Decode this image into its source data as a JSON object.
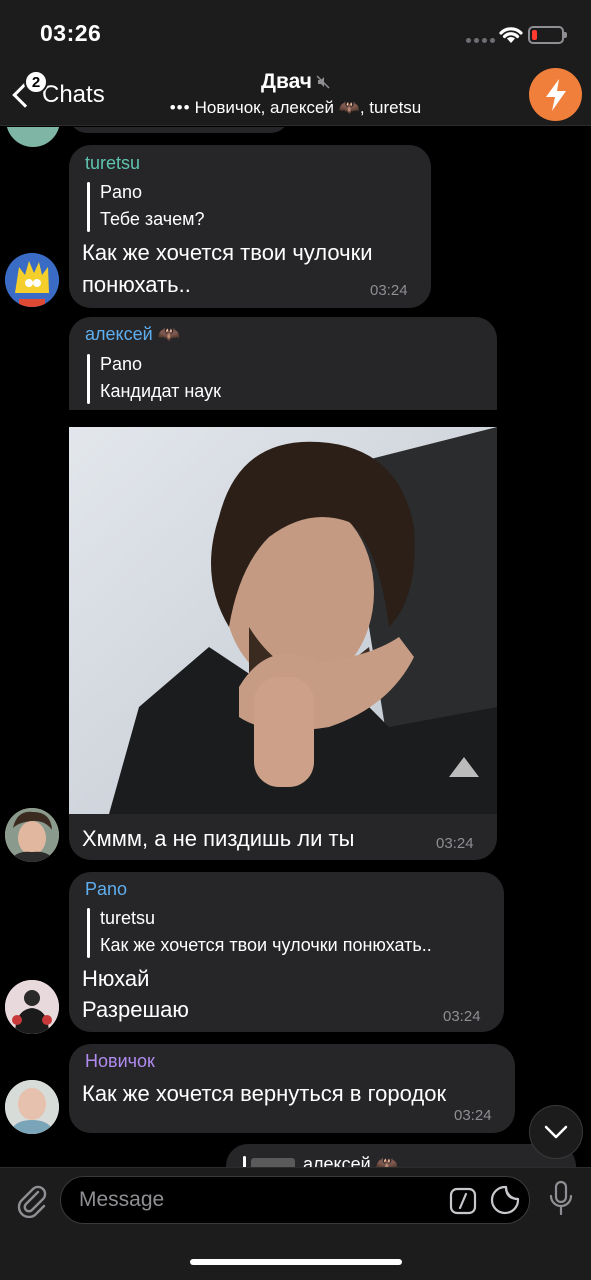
{
  "status_bar": {
    "time": "03:26"
  },
  "header": {
    "back_label": "Chats",
    "unread_badge": "2",
    "title": "Двач",
    "subtitle_dots": "•••",
    "subtitle": "Новичок, алексей 🦇, turetsu"
  },
  "messages": [
    {
      "sender": "turetsu",
      "sender_color": "#5ec4b0",
      "reply_name": "Pano",
      "reply_text": "Тебе зачем?",
      "lines": [
        "Как же хочется твои чулочки",
        "понюхать.."
      ],
      "time": "03:24"
    },
    {
      "sender": "алексей 🦇",
      "sender_color": "#5eaef0",
      "reply_name": "Pano",
      "reply_text": "Кандидат наук",
      "photo": "photo of a bearded man with long dark hair, hand on chin",
      "lines": [
        "Хммм, а не пиздишь ли ты"
      ],
      "time": "03:24"
    },
    {
      "sender": "Pano",
      "sender_color": "#5eaef0",
      "reply_name": "turetsu",
      "reply_text": "Как же хочется твои чулочки понюхать..",
      "lines": [
        "Нюхай",
        "Разрешаю"
      ],
      "time": "03:24"
    },
    {
      "sender": "Новичок",
      "sender_color": "#b18cf0",
      "lines": [
        "Как же хочется вернуться в городок"
      ],
      "time": "03:24"
    },
    {
      "reply_name": "алексей 🦇"
    }
  ],
  "input": {
    "placeholder": "Message"
  },
  "colors": {
    "bubble": "#262628",
    "accent": "#f07f3b",
    "bar": "#1c1c1d"
  },
  "icons": [
    "back-chevron-icon",
    "mute-icon",
    "attach-icon",
    "command-icon",
    "sticker-icon",
    "microphone-icon",
    "scroll-down-icon",
    "wifi-icon",
    "battery-icon"
  ]
}
